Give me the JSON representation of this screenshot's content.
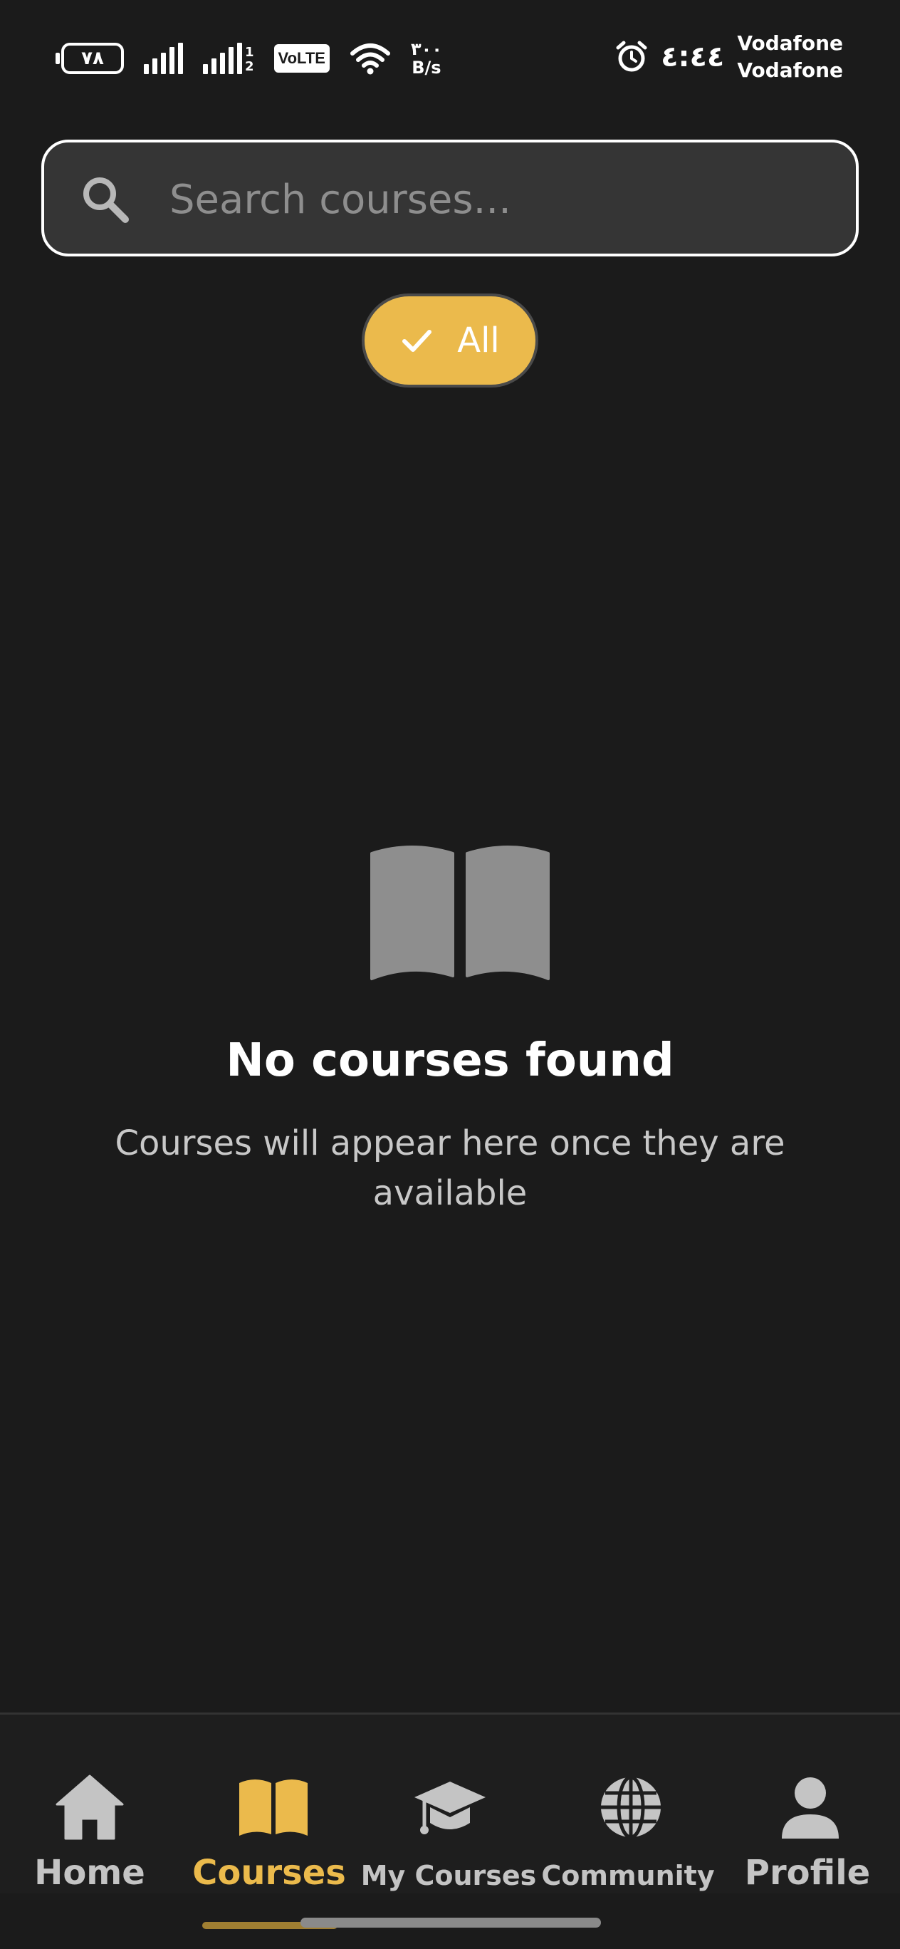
{
  "status_bar": {
    "battery_level": "٧٨",
    "signal_sim_labels": [
      "1",
      "2"
    ],
    "volte": "VoLTE",
    "net_speed_value": "٣٠٠",
    "net_speed_unit": "B/s",
    "time": "٤:٤٤",
    "carriers": [
      "Vodafone",
      "Vodafone"
    ]
  },
  "search": {
    "placeholder": "Search courses...",
    "value": ""
  },
  "filters": {
    "selected_chip": {
      "label": "All",
      "selected": true
    }
  },
  "empty_state": {
    "title": "No courses found",
    "subtitle": "Courses will appear here once they are available",
    "icon": "book-icon"
  },
  "bottom_nav": {
    "items": [
      {
        "label": "Home",
        "icon": "home-icon",
        "active": false
      },
      {
        "label": "Courses",
        "icon": "book-icon",
        "active": true
      },
      {
        "label": "My Courses",
        "icon": "graduation-cap-icon",
        "active": false
      },
      {
        "label": "Community",
        "icon": "globe-icon",
        "active": false
      },
      {
        "label": "Profile",
        "icon": "person-icon",
        "active": false
      }
    ]
  },
  "colors": {
    "background": "#1b1b1b",
    "accent": "#ebba4c",
    "inactive": "#c4c4c4",
    "icon_gray": "#8e8e8e"
  }
}
